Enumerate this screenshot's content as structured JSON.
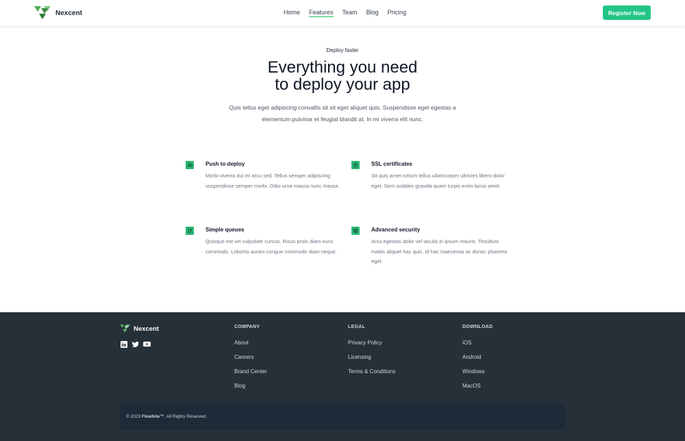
{
  "header": {
    "brand": "Nexcent",
    "nav": [
      "Home",
      "Features",
      "Team",
      "Blog",
      "Pricing"
    ],
    "active_nav": "Features",
    "register_label": "Register Now"
  },
  "hero": {
    "eyebrow": "Deploy faster",
    "title_line1": "Everything you need",
    "title_line2": "to deploy your app",
    "description": "Quis tellus eget adipiscing convallis sit sit eget aliquet quis. Suspendisse eget egestas a elementum pulvinar et feugiat blandit at. In mi viverra elit nunc."
  },
  "features": [
    {
      "title": "Push to deploy",
      "description": "Morbi viverra dui mi arcu sed. Tellus semper adipiscing suspendisse semper morbi. Odio urna massa nunc massa.",
      "icon": "cloud-upload-icon"
    },
    {
      "title": "SSL certificates",
      "description": "Sit quis amet rutrum tellus ullamcorper ultricies libero dolor eget. Sem sodales gravida quam turpis enim lacus amet.",
      "icon": "lock-icon"
    },
    {
      "title": "Simple queues",
      "description": "Quisque est vel vulputate cursus. Risus proin diam nunc commodo. Lobortis auctor congue commodo diam neque.",
      "icon": "refresh-icon"
    },
    {
      "title": "Advanced security",
      "description": "Arcu egestas dolor vel iaculis in ipsum mauris. Tincidunt mattis aliquet hac quis. Id hac maecenas ac donec pharetra eget.",
      "icon": "fingerprint-icon"
    }
  ],
  "footer": {
    "brand": "Nexcent",
    "socials": [
      "linkedin-icon",
      "twitter-icon",
      "youtube-icon"
    ],
    "columns": [
      {
        "title": "COMPANY",
        "links": [
          "About",
          "Careers",
          "Brand Center",
          "Blog"
        ]
      },
      {
        "title": "LEGAL",
        "links": [
          "Privacy Policy",
          "Licensing",
          "Terms & Conditions"
        ]
      },
      {
        "title": "DOWNLOAD",
        "links": [
          "iOS",
          "Android",
          "Windows",
          "MacOS"
        ]
      }
    ],
    "copyright_prefix": "© 2023 ",
    "copyright_brand": "Flowbite™",
    "copyright_suffix": ". All Rights Reserved."
  },
  "colors": {
    "accent": "#22c586",
    "footer_bg": "#263039",
    "copyright_bg": "#1f2a38"
  }
}
